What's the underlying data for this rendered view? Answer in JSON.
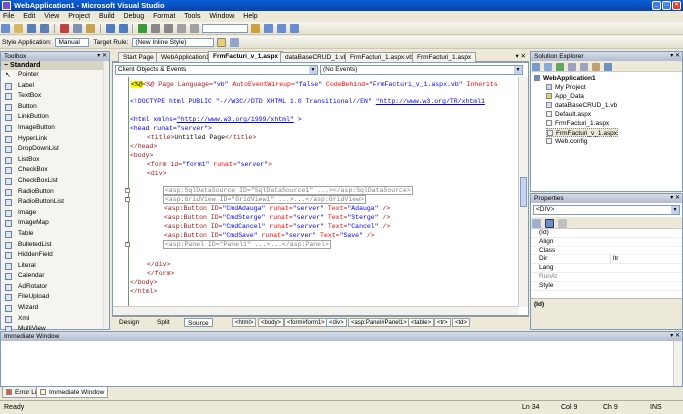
{
  "window": {
    "title": "WebApplication1 - Microsoft Visual Studio",
    "min": "_",
    "max": "□",
    "close": "×"
  },
  "menu": [
    "File",
    "Edit",
    "View",
    "Project",
    "Build",
    "Debug",
    "Format",
    "Tools",
    "Window",
    "Help"
  ],
  "formatbar": {
    "style_app_label": "Style Application:",
    "style_app_value": "Manual",
    "target_rule_label": "Target Rule:",
    "target_rule_value": "(New Inline Style)"
  },
  "toolbox": {
    "title": "Toolbox",
    "category": "Standard",
    "items": [
      "Pointer",
      "Label",
      "TextBox",
      "Button",
      "LinkButton",
      "ImageButton",
      "HyperLink",
      "DropDownList",
      "ListBox",
      "CheckBox",
      "CheckBoxList",
      "RadioButton",
      "RadioButtonList",
      "Image",
      "ImageMap",
      "Table",
      "BulletedList",
      "HiddenField",
      "Literal",
      "Calendar",
      "AdRotator",
      "FileUpload",
      "Wizard",
      "Xml",
      "MultiView"
    ]
  },
  "doc_tabs": [
    "Start Page",
    "WebApplication1",
    "FrmFacturi_v_1.aspx",
    "dataBaseCRUD_1.vb",
    "FrmFacturi_1.aspx.vb",
    "FrmFacturi_1.aspx"
  ],
  "editor": {
    "object_combo": "Client Objects & Events",
    "event_combo": "(No Events)"
  },
  "code": {
    "l1": {
      "a": "<%@ Page Language=",
      "b": "\"vb\"",
      "c": " AutoEventWireup=",
      "d": "\"false\"",
      "e": " CodeBehind=",
      "f": "\"FrmFacturi_v_1.aspx.vb\"",
      "g": " Inherits"
    },
    "l2": {
      "a": "<!DOCTYPE html PUBLIC \"-//W3C//DTD XHTML 1.0 Transitional//EN\" ",
      "b": "\"http://www.w3.org/TR/xhtml1"
    },
    "l3": {
      "a": "<html xmlns=",
      "b": "\"http://www.w3.org/1999/xhtml\"",
      "c": " >"
    },
    "l4": {
      "a": "<head runat=",
      "b": "\"server\"",
      "c": ">"
    },
    "l5": {
      "a": "<title>",
      "b": "Untitled Page",
      "c": "</title>"
    },
    "l6": "</head>",
    "l7": "<body>",
    "l8": {
      "a": "<form id=",
      "b": "\"form1\"",
      "c": " runat=",
      "d": "\"server\"",
      "e": ">"
    },
    "l9": "<div>",
    "l10": "<asp:SqlDataSource ID=\"SqlDataSource1\" ...></asp:SqlDataSource>",
    "l11": "<asp:GridView ID=\"GridView1\" ...>...</asp:GridView>",
    "btns": [
      {
        "id": "\"CmdAdauga\"",
        "text": "\"Adauga\""
      },
      {
        "id": "\"CmdSterge\"",
        "text": "\"Sterge\""
      },
      {
        "id": "\"CmdCancel\"",
        "text": "\"Cancel\""
      },
      {
        "id": "\"CmdSave\"",
        "text": "\"Save\""
      }
    ],
    "btn_pre": "<asp:Button ID=",
    "btn_runat": " runat=",
    "btn_server": "\"server\"",
    "btn_text": " Text=",
    "btn_end": " />",
    "l16": "<asp:Panel ID=\"Panel1\" ...>...</asp:Panel>",
    "l17": "</div>",
    "l18": "</form>",
    "l19": "</body>",
    "l20": "</html>"
  },
  "designbar": {
    "design": "Design",
    "split": "Split",
    "source": "Source",
    "crumbs": [
      "<html>",
      "<body>",
      "<form#form1>",
      "<div>",
      "<asp:Panel#Panel1>",
      "<table>",
      "<tr>",
      "<td>"
    ]
  },
  "solution_explorer": {
    "title": "Solution Explorer",
    "root": "WebApplication1",
    "items": [
      "My Project",
      "App_Data",
      "dataBaseCRUD_1.vb",
      "Default.aspx",
      "FrmFacturi_1.aspx",
      "FrmFacturi_v_1.aspx",
      "Web.config"
    ]
  },
  "properties": {
    "title": "Properties",
    "combo": "<DIV>",
    "rows": [
      {
        "k": "(Id)",
        "v": ""
      },
      {
        "k": "Align",
        "v": ""
      },
      {
        "k": "Class",
        "v": ""
      },
      {
        "k": "Dir",
        "v": "ltr"
      },
      {
        "k": "Lang",
        "v": ""
      },
      {
        "k": "RunAt",
        "v": ""
      },
      {
        "k": "Style",
        "v": ""
      }
    ],
    "desc": "(Id)"
  },
  "immediate": {
    "title": "Immediate Window"
  },
  "bottom_tabs": [
    "Error List",
    "Immediate Window"
  ],
  "status": {
    "ready": "Ready",
    "ln": "Ln 34",
    "col": "Col 9",
    "ch": "Ch 9",
    "ins": "INS"
  }
}
